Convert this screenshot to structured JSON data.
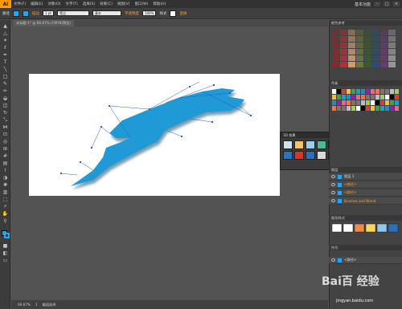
{
  "app": {
    "logo": "Ai"
  },
  "menu": [
    "文件(F)",
    "编辑(E)",
    "对象(O)",
    "文字(T)",
    "选择(S)",
    "效果(C)",
    "视图(V)",
    "窗口(W)",
    "帮助(H)"
  ],
  "workspace_label": "基本功能",
  "control": {
    "object_label": "路径",
    "stroke_label": "描边",
    "stroke_weight": "1 pt",
    "profile_label": "等比",
    "brush_label": "基本",
    "opacity_label": "不透明度",
    "opacity_value": "100%",
    "style_label": "样式",
    "transform_label": "变换"
  },
  "document": {
    "tab": "未标题-1* @ 66.67% (CMYK/预览)"
  },
  "status": {
    "zoom": "66.67%",
    "page": "1",
    "tool": "编组选择"
  },
  "panels": {
    "color_title": "颜色参考",
    "swatch_title": "色板",
    "layers_title": "图层",
    "layer_rows": [
      "图层 1",
      "<路径>",
      "<路径>",
      "Brushes and Blend"
    ],
    "appearance_title": "图形样式",
    "symbols_title": "符号",
    "bottom_layer": "<路径>"
  },
  "float_panel": {
    "title": "3D 效果"
  },
  "colors": {
    "accent": "#27a4ff",
    "shape": "#1f9ad6"
  },
  "watermark": {
    "text": "Bai百 经验",
    "url": "jingyan.baidu.com"
  }
}
